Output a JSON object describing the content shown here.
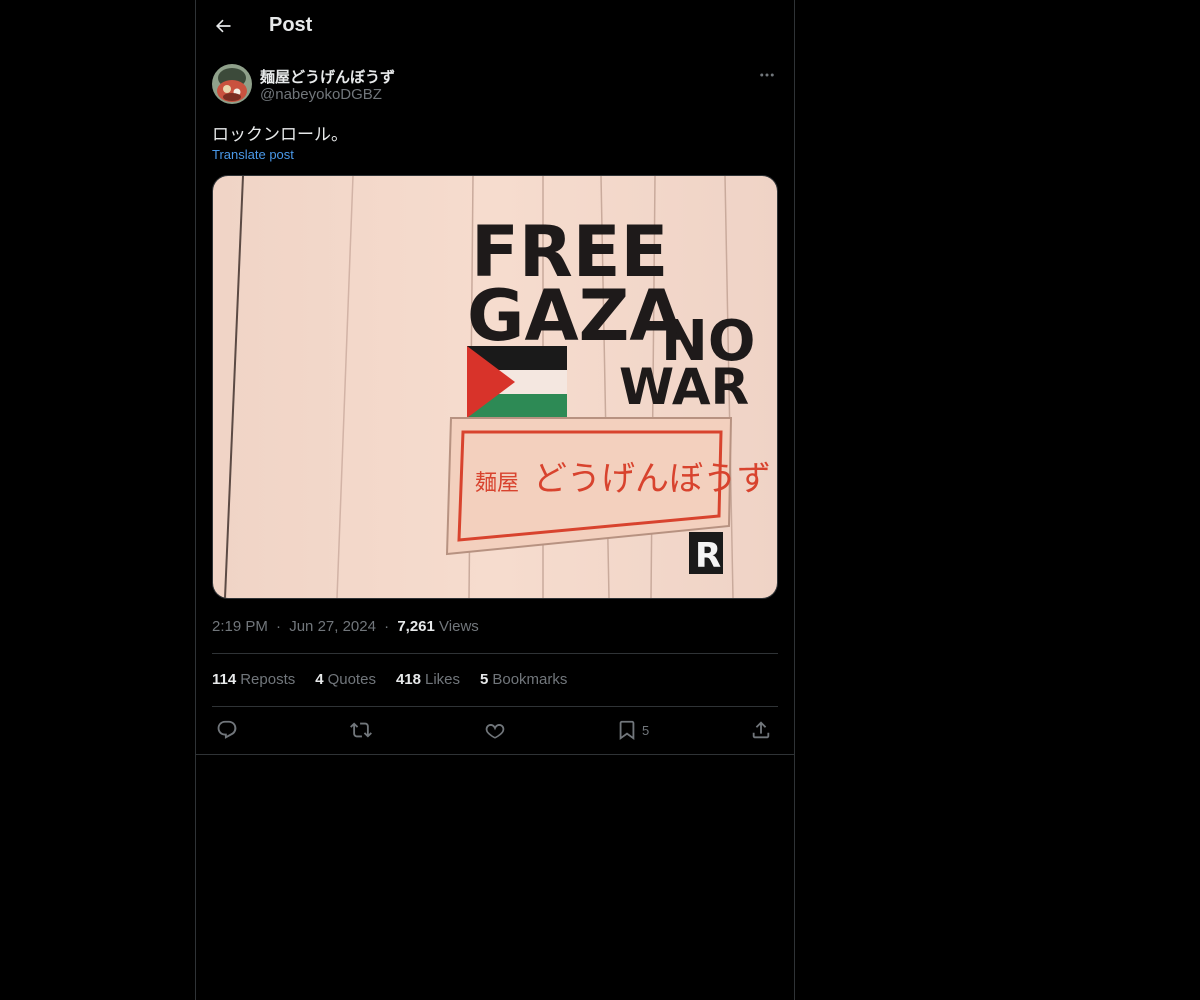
{
  "header": {
    "title": "Post"
  },
  "author": {
    "display_name": "麺屋どうげんぼうず",
    "handle": "@nabeyokoDGBZ"
  },
  "post": {
    "text": "ロックンロール。",
    "translate_label": "Translate post"
  },
  "media": {
    "sign_line1": "FREE",
    "sign_line2": "GAZA",
    "sign_line3": "NO",
    "sign_line4": "WAR",
    "sign_small": "麺屋",
    "sign_large": "どうげんぼうず",
    "sign_letter": "R"
  },
  "meta": {
    "time": "2:19 PM",
    "separator": "·",
    "date": "Jun 27, 2024",
    "views_count": "7,261",
    "views_label": "Views"
  },
  "stats": {
    "reposts_count": "114",
    "reposts_label": "Reposts",
    "quotes_count": "4",
    "quotes_label": "Quotes",
    "likes_count": "418",
    "likes_label": "Likes",
    "bookmarks_count": "5",
    "bookmarks_label": "Bookmarks"
  },
  "actions": {
    "bookmark_count": "5"
  },
  "colors": {
    "background": "#000000",
    "text_primary": "#e7e9ea",
    "text_secondary": "#71767b",
    "link": "#4a99e9",
    "border": "#2f3336"
  },
  "icons": {
    "back": "arrow-left-icon",
    "more": "ellipsis-icon",
    "reply": "reply-icon",
    "repost": "repost-icon",
    "like": "heart-icon",
    "bookmark": "bookmark-icon",
    "share": "share-icon"
  }
}
